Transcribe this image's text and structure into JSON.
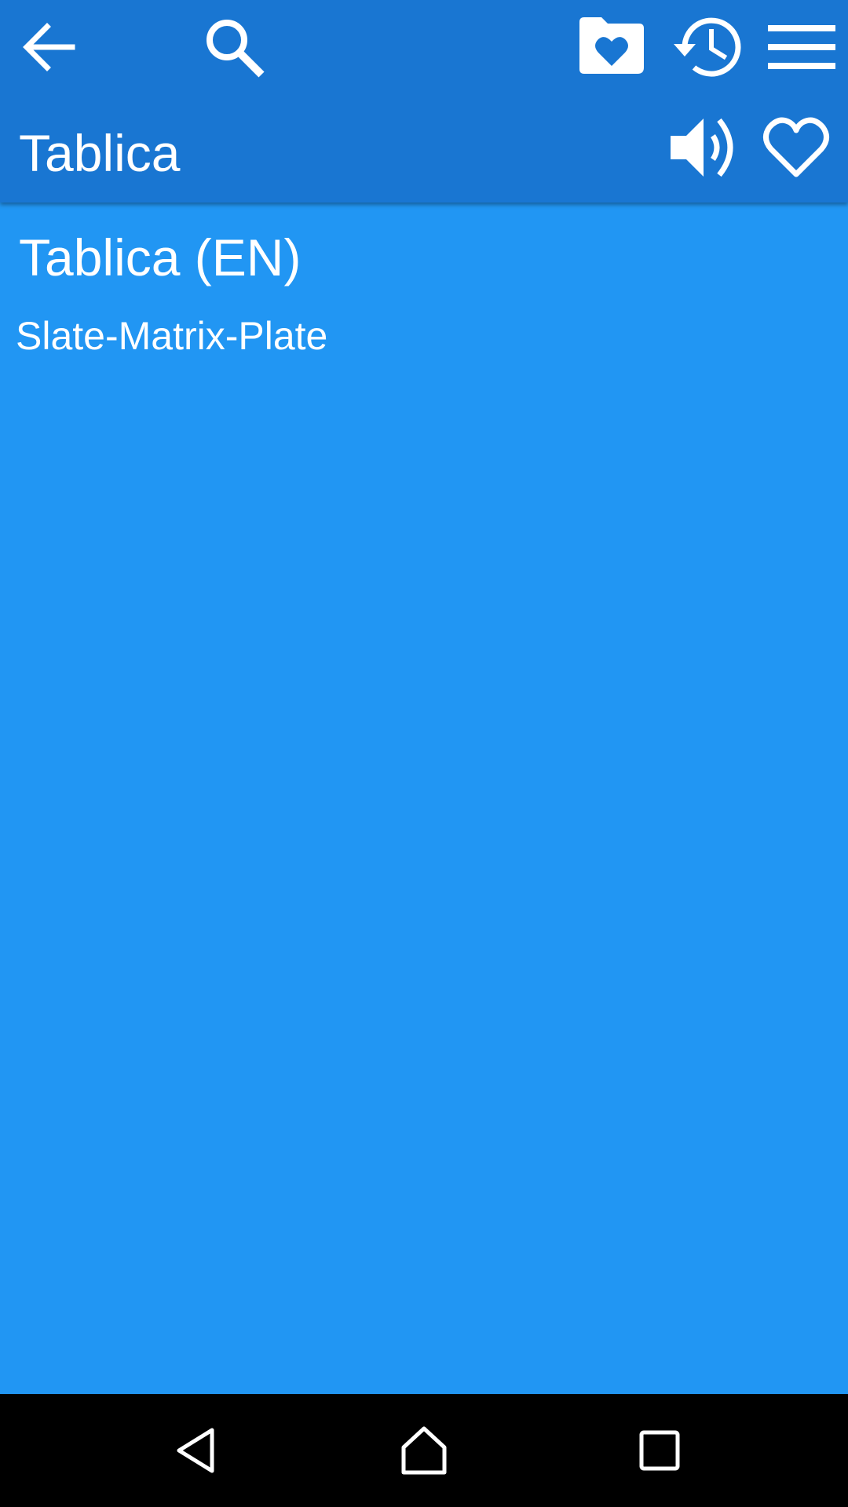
{
  "toolbar": {
    "back_icon": "arrow-left-icon",
    "search_icon": "search-icon",
    "favorites_folder_icon": "folder-heart-icon",
    "history_icon": "history-icon",
    "menu_icon": "menu-icon"
  },
  "header": {
    "word": "Tablica",
    "speaker_icon": "speaker-icon",
    "favorite_icon": "heart-outline-icon"
  },
  "entry": {
    "heading": "Tablica (EN)",
    "translation": "Slate-Matrix-Plate"
  },
  "system_nav": {
    "back_icon": "triangle-back-icon",
    "home_icon": "home-icon",
    "recents_icon": "square-recents-icon"
  },
  "colors": {
    "app_bar": "#1976D2",
    "content_background": "#2196F3",
    "nav_bar": "#000000",
    "foreground": "#FFFFFF"
  }
}
